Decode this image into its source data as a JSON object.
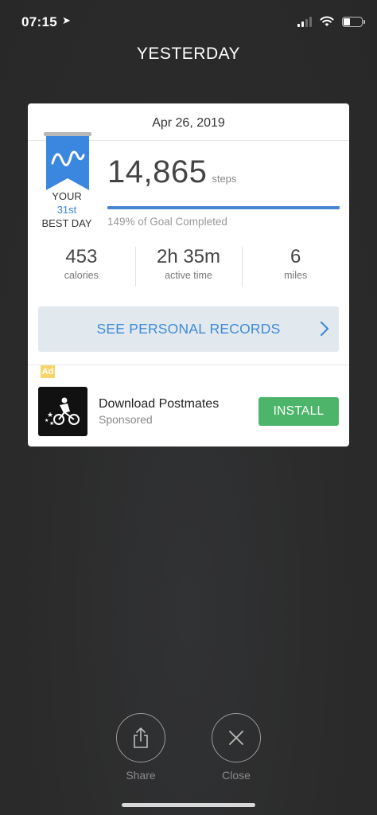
{
  "status_bar": {
    "time": "07:15"
  },
  "header": {
    "title": "YESTERDAY"
  },
  "card": {
    "date": "Apr 26, 2019",
    "badge": {
      "line1": "YOUR",
      "rank": "31st",
      "line3": "BEST DAY"
    },
    "steps": {
      "value": "14,865",
      "unit": "steps"
    },
    "goal": {
      "text": "149% of Goal Completed",
      "percent": 149
    },
    "stats": [
      {
        "value": "453",
        "label": "calories"
      },
      {
        "value": "2h 35m",
        "label": "active time"
      },
      {
        "value": "6",
        "label": "miles"
      }
    ],
    "records_button": "SEE PERSONAL RECORDS",
    "ad": {
      "tag": "Ad",
      "title": "Download Postmates",
      "subtitle": "Sponsored",
      "cta": "INSTALL"
    }
  },
  "actions": {
    "share": "Share",
    "close": "Close"
  },
  "colors": {
    "accent_blue": "#3f8ad9",
    "install_green": "#4db56a",
    "ad_tag_yellow": "#f9d56a",
    "ribbon_blue": "#3b87e0"
  },
  "icons": {
    "ribbon": "ribbon-badge-icon",
    "records_chevron": "chevron-right-icon",
    "share": "share-icon",
    "close": "close-icon"
  }
}
